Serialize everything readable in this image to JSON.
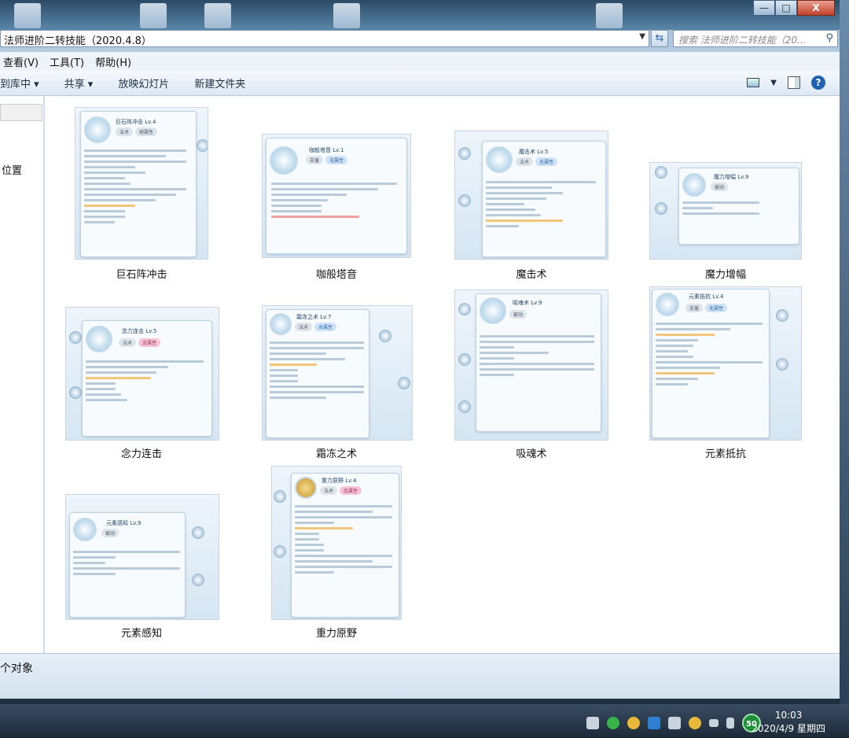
{
  "window": {
    "address": "法师进阶二转技能（2020.4.8）",
    "search_placeholder": "搜索 法师进阶二转技能（20...",
    "controls": {
      "minimize": "—",
      "maximize": "□",
      "close": "X"
    }
  },
  "menubar": {
    "items": [
      "查看(V)",
      "工具(T)",
      "帮助(H)"
    ]
  },
  "toolbar": {
    "include_library": "到库中 ▾",
    "share": "共享 ▾",
    "slideshow": "放映幻灯片",
    "new_folder": "新建文件夹"
  },
  "nav": {
    "location_label": "位置"
  },
  "files": [
    {
      "name": "巨石阵冲击",
      "card_title": "巨石阵冲击 Lv.4",
      "tags": [
        "法术",
        "地属性"
      ]
    },
    {
      "name": "咖般塔音",
      "card_title": "咖般塔音 Lv.1",
      "tags": [
        "支援",
        "无属性"
      ]
    },
    {
      "name": "魔击术",
      "card_title": "魔击术 Lv.5",
      "tags": [
        "法术",
        "无属性"
      ]
    },
    {
      "name": "魔力增幅",
      "card_title": "魔力增幅 Lv.9",
      "tags": [
        "被动"
      ]
    },
    {
      "name": "念力连击",
      "card_title": "念力连击 Lv.5",
      "tags": [
        "法术",
        "念属性"
      ]
    },
    {
      "name": "霜冻之术",
      "card_title": "霜冻之术 Lv.7",
      "tags": [
        "法术",
        "水属性"
      ]
    },
    {
      "name": "吸魂术",
      "card_title": "吸魂术 Lv.9",
      "tags": [
        "被动"
      ]
    },
    {
      "name": "元素抵抗",
      "card_title": "元素抵抗 Lv.4",
      "tags": [
        "支援",
        "无属性"
      ]
    },
    {
      "name": "元素感知",
      "card_title": "元素感知 Lv.9",
      "tags": [
        "被动"
      ]
    },
    {
      "name": "重力原野",
      "card_title": "重力原野 Lv.4",
      "tags": [
        "法术",
        "念属性"
      ]
    }
  ],
  "status": {
    "count_text": "个对象"
  },
  "taskbar": {
    "tray_badge": "50",
    "time": "10:03",
    "date": "2020/4/9 星期四"
  }
}
